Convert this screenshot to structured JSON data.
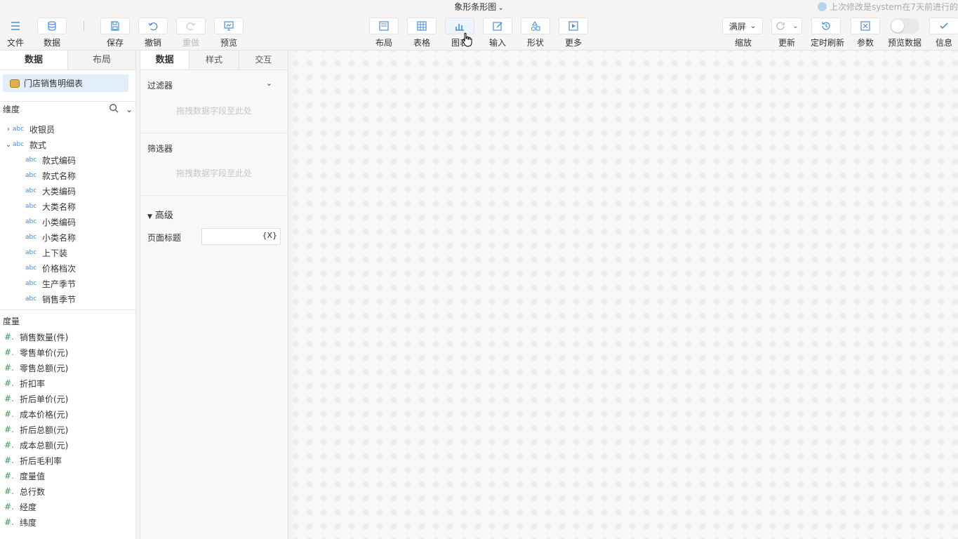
{
  "title": "象形条形图",
  "notice": "上次修改是system在7天前进行的",
  "toolbar": {
    "file": "文件",
    "data": "数据",
    "save": "保存",
    "undo": "撤销",
    "redo": "重做",
    "preview": "预览",
    "layout": "布局",
    "table": "表格",
    "chart": "图表",
    "input": "输入",
    "shape": "形状",
    "more": "更多",
    "zoom_value": "满屏",
    "zoom": "缩放",
    "refresh": "更新",
    "timed_refresh": "定时刷新",
    "params": "参数",
    "preview_data": "预览数据",
    "info": "信息"
  },
  "left": {
    "tabs": [
      "数据",
      "布局"
    ],
    "dataset": "门店销售明细表",
    "dimension_label": "维度",
    "dimensions": [
      {
        "label": "收银员",
        "level": 0,
        "caret": "›"
      },
      {
        "label": "款式",
        "level": 0,
        "caret": "⌄"
      },
      {
        "label": "款式编码",
        "level": 1
      },
      {
        "label": "款式名称",
        "level": 1
      },
      {
        "label": "大类编码",
        "level": 1
      },
      {
        "label": "大类名称",
        "level": 1
      },
      {
        "label": "小类编码",
        "level": 1
      },
      {
        "label": "小类名称",
        "level": 1
      },
      {
        "label": "上下装",
        "level": 1
      },
      {
        "label": "价格档次",
        "level": 1
      },
      {
        "label": "生产季节",
        "level": 1
      },
      {
        "label": "销售季节",
        "level": 1
      }
    ],
    "measure_label": "度量",
    "measures": [
      "销售数量(件)",
      "零售单价(元)",
      "零售总额(元)",
      "折扣率",
      "折后单价(元)",
      "成本价格(元)",
      "折后总额(元)",
      "成本总额(元)",
      "折后毛利率",
      "度量值",
      "总行数",
      "经度",
      "纬度"
    ]
  },
  "mid": {
    "tabs": [
      "数据",
      "样式",
      "交互"
    ],
    "filter_label": "过滤器",
    "filter_placeholder": "拖拽数据字段至此处",
    "selector_label": "筛选器",
    "selector_placeholder": "拖拽数据字段至此处",
    "advanced_label": "高级",
    "page_title_label": "页面标题",
    "page_title_value": "",
    "var_icon": "{X}"
  }
}
